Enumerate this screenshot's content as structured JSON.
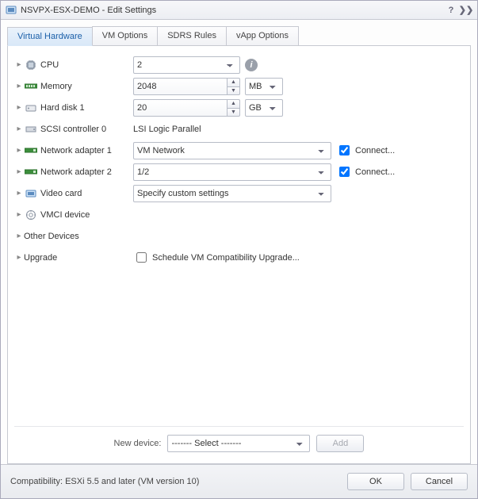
{
  "window": {
    "title": "NSVPX-ESX-DEMO - Edit Settings"
  },
  "tabs": {
    "virtual_hardware": "Virtual Hardware",
    "vm_options": "VM Options",
    "sdrs_rules": "SDRS Rules",
    "vapp_options": "vApp Options"
  },
  "rows": {
    "cpu": {
      "label": "CPU",
      "value": "2"
    },
    "memory": {
      "label": "Memory",
      "value": "2048",
      "unit": "MB"
    },
    "hard_disk_1": {
      "label": "Hard disk 1",
      "value": "20",
      "unit": "GB"
    },
    "scsi0": {
      "label": "SCSI controller 0",
      "value": "LSI Logic Parallel"
    },
    "net1": {
      "label": "Network adapter 1",
      "value": "VM Network",
      "connect": "Connect..."
    },
    "net2": {
      "label": "Network adapter 2",
      "value": "1/2",
      "connect": "Connect..."
    },
    "video": {
      "label": "Video card",
      "value": "Specify custom settings"
    },
    "vmci": {
      "label": "VMCI device"
    },
    "other": {
      "label": "Other Devices"
    },
    "upgrade": {
      "label": "Upgrade",
      "checkbox": "Schedule VM Compatibility Upgrade..."
    }
  },
  "new_device": {
    "label": "New device:",
    "placeholder": "------- Select -------",
    "add": "Add"
  },
  "footer": {
    "compat": "Compatibility: ESXi 5.5 and later (VM version 10)",
    "ok": "OK",
    "cancel": "Cancel"
  }
}
